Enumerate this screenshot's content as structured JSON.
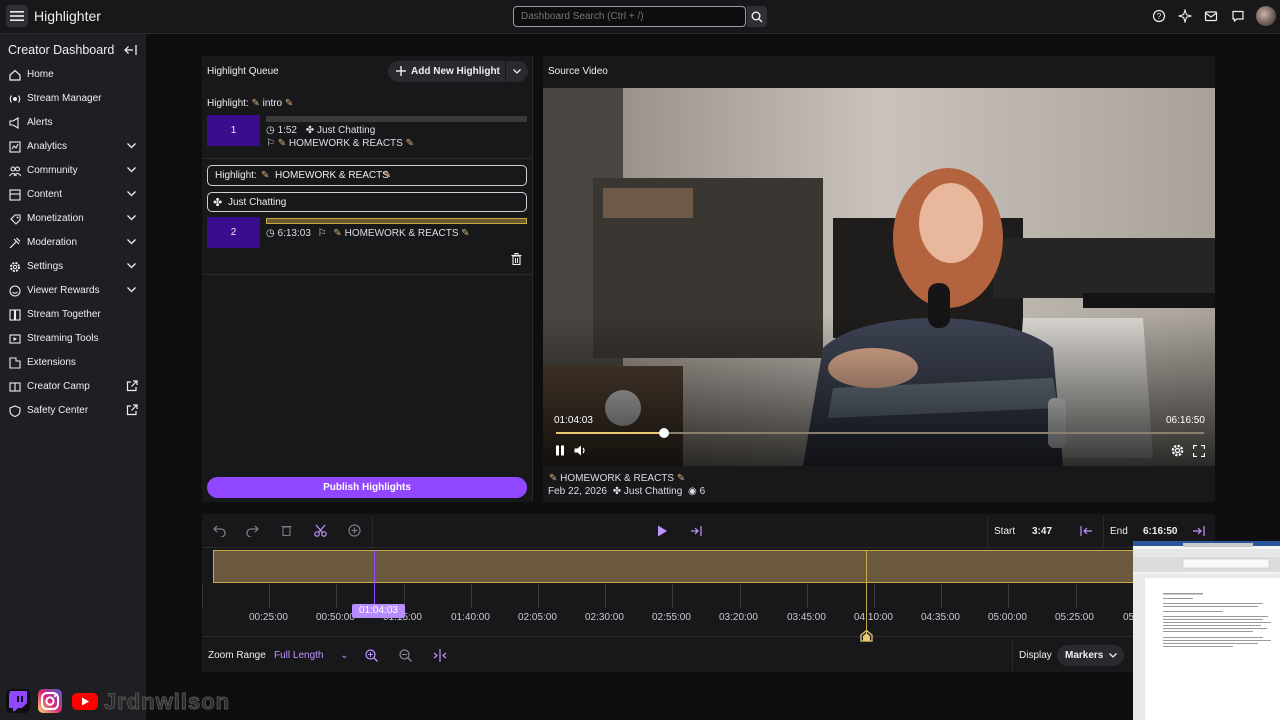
{
  "app": {
    "title": "Highlighter"
  },
  "search": {
    "placeholder": "Dashboard Search (Ctrl + /)"
  },
  "sidebar": {
    "title": "Creator Dashboard",
    "items": [
      {
        "label": "Home",
        "icon": "home-icon",
        "chevron": false,
        "external": false
      },
      {
        "label": "Stream Manager",
        "icon": "stream-manager-icon",
        "chevron": false,
        "external": false
      },
      {
        "label": "Alerts",
        "icon": "alerts-icon",
        "chevron": false,
        "external": false
      },
      {
        "label": "Analytics",
        "icon": "analytics-icon",
        "chevron": true,
        "external": false
      },
      {
        "label": "Community",
        "icon": "community-icon",
        "chevron": true,
        "external": false
      },
      {
        "label": "Content",
        "icon": "content-icon",
        "chevron": true,
        "external": false
      },
      {
        "label": "Monetization",
        "icon": "monetization-icon",
        "chevron": true,
        "external": false
      },
      {
        "label": "Moderation",
        "icon": "moderation-icon",
        "chevron": true,
        "external": false
      },
      {
        "label": "Settings",
        "icon": "settings-icon",
        "chevron": true,
        "external": false
      },
      {
        "label": "Viewer Rewards",
        "icon": "viewer-rewards-icon",
        "chevron": true,
        "external": false
      },
      {
        "label": "Stream Together",
        "icon": "stream-together-icon",
        "chevron": false,
        "external": false
      },
      {
        "label": "Streaming Tools",
        "icon": "streaming-tools-icon",
        "chevron": false,
        "external": false
      },
      {
        "label": "Extensions",
        "icon": "extensions-icon",
        "chevron": false,
        "external": false
      },
      {
        "label": "Creator Camp",
        "icon": "creator-camp-icon",
        "chevron": false,
        "external": true
      },
      {
        "label": "Safety Center",
        "icon": "safety-center-icon",
        "chevron": false,
        "external": true
      }
    ]
  },
  "queue": {
    "title": "Highlight Queue",
    "add_label": "Add New Highlight",
    "group1": {
      "heading_prefix": "Highlight:",
      "heading_name": "intro",
      "number": "1",
      "duration": "1:52",
      "category": "Just Chatting",
      "title": "HOMEWORK & REACTS"
    },
    "group2": {
      "title_field_prefix": "Highlight:",
      "title_field_value": "HOMEWORK & REACTS",
      "category_field": "Just Chatting",
      "number": "2",
      "duration": "6:13:03",
      "title": "HOMEWORK & REACTS"
    },
    "publish_label": "Publish Highlights"
  },
  "source_video": {
    "title": "Source Video",
    "current_time": "01:04:03",
    "total_time": "06:16:50",
    "progress": 0.165,
    "stream_title": "HOMEWORK & REACTS",
    "date": "Feb 22, 2026",
    "category": "Just Chatting",
    "views": "6"
  },
  "timeline": {
    "start_label": "Start",
    "start_value": "3:47",
    "end_label": "End",
    "end_value": "6:16:50",
    "ticks": [
      "00:25:00",
      "00:50:00",
      "01:15:00",
      "01:40:00",
      "02:05:00",
      "02:30:00",
      "02:55:00",
      "03:20:00",
      "03:45:00",
      "04:10:00",
      "04:35:00",
      "05:00:00",
      "05:25:00",
      "05:"
    ],
    "playhead_time": "01:04:03",
    "zoom_range_label": "Zoom Range",
    "zoom_range_value": "Full Length",
    "display_label": "Display",
    "display_value": "Markers"
  },
  "overlay": {
    "username": "Jrdnwilson"
  },
  "colors": {
    "accent": "#9147ff",
    "clip_gold": "#c8a94a",
    "highlight_box": "#3a0c8e"
  }
}
